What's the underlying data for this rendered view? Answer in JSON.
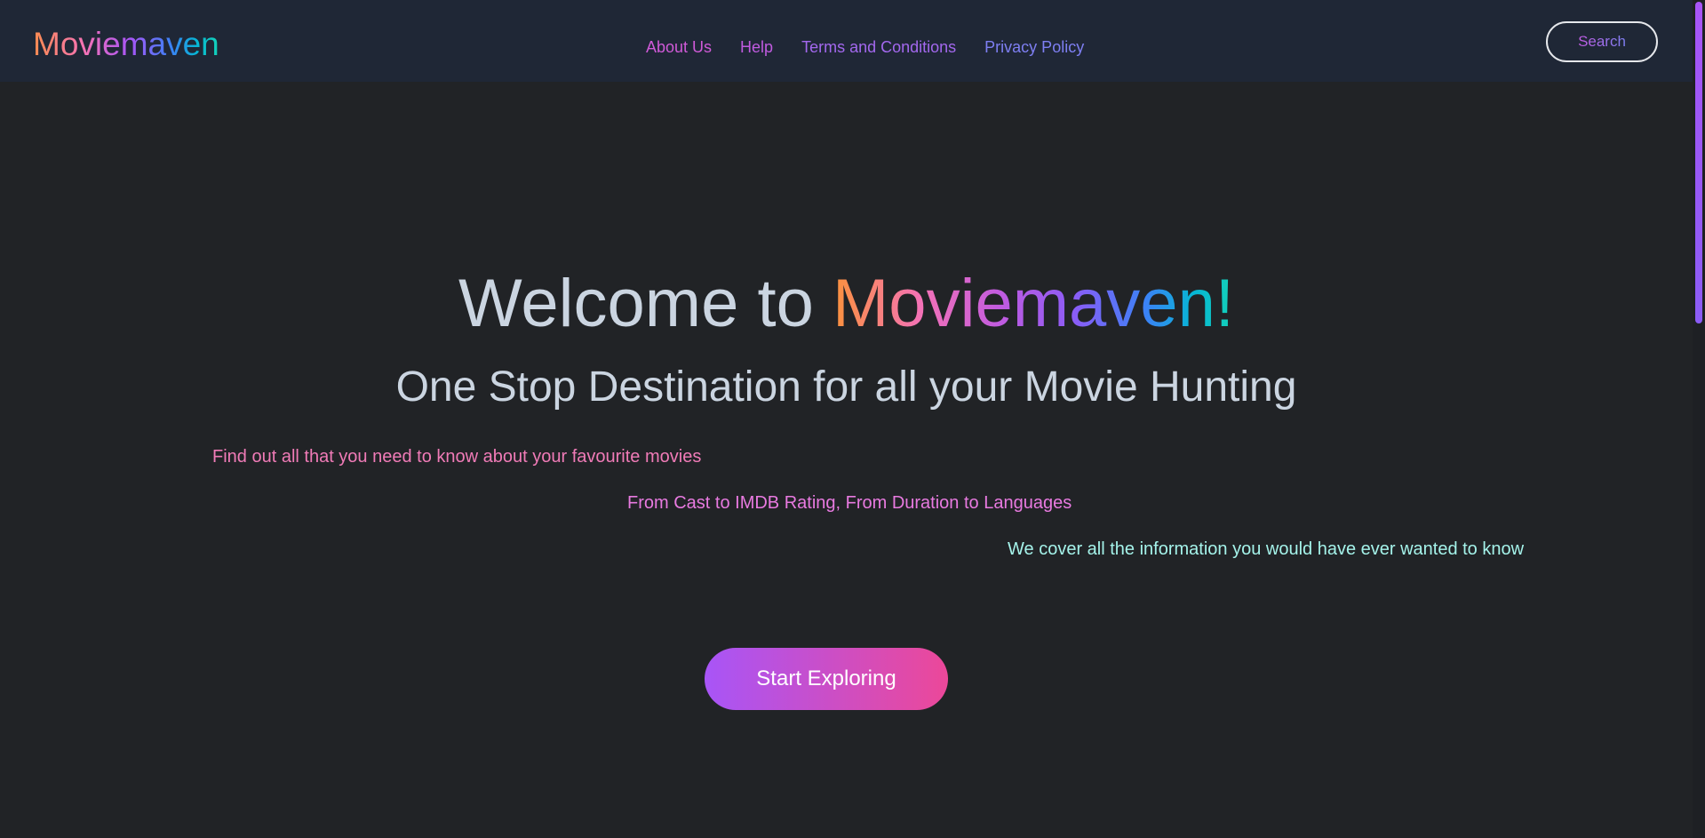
{
  "brand": {
    "name": "Moviemaven"
  },
  "nav": {
    "items": [
      {
        "label": "About Us"
      },
      {
        "label": "Help"
      },
      {
        "label": "Terms and Conditions"
      },
      {
        "label": "Privacy Policy"
      }
    ]
  },
  "search": {
    "label": "Search"
  },
  "hero": {
    "title_prefix": "Welcome to ",
    "title_brand": "Moviemaven!",
    "subtitle": "One Stop Destination for all your Movie Hunting",
    "lines": [
      "Find out all that you need to know about your favourite movies",
      "From Cast to IMDB Rating, From Duration to Languages",
      "We cover all the information you would have ever wanted to know"
    ],
    "cta_label": "Start Exploring"
  },
  "colors": {
    "background": "#212326",
    "navbar": "#1f2736",
    "accent_purple": "#a855f7",
    "accent_pink": "#ec4899"
  }
}
